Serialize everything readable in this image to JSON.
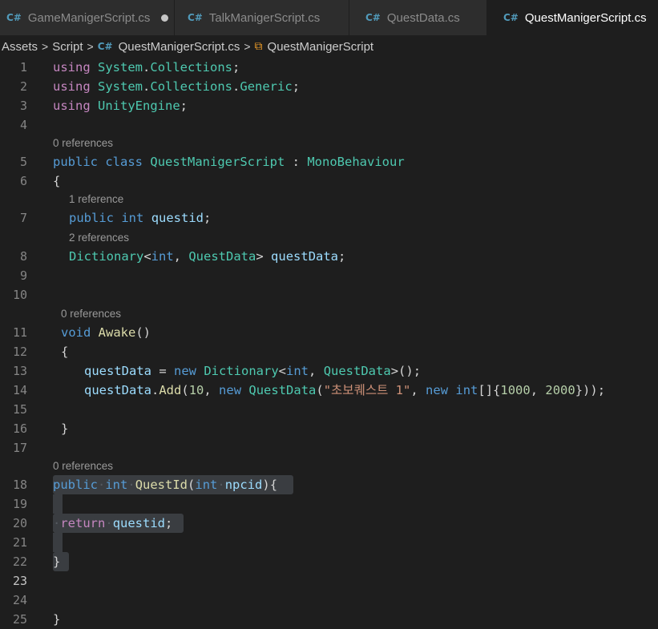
{
  "tabs": [
    {
      "label": "GameManigerScript.cs",
      "modified": true,
      "active": false
    },
    {
      "label": "TalkManigerScript.cs",
      "modified": false,
      "active": false
    },
    {
      "label": "QuestData.cs",
      "modified": false,
      "active": false
    },
    {
      "label": "QuestManigerScript.cs",
      "modified": false,
      "active": true
    }
  ],
  "breadcrumb": {
    "folder1": "Assets",
    "folder2": "Script",
    "file": "QuestManigerScript.cs",
    "symbol": "QuestManigerScript"
  },
  "editor": {
    "line_numbers": [
      "1",
      "2",
      "3",
      "4",
      "5",
      "6",
      "7",
      "8",
      "9",
      "10",
      "11",
      "12",
      "13",
      "14",
      "15",
      "16",
      "17",
      "18",
      "19",
      "20",
      "21",
      "22",
      "23",
      "24",
      "25"
    ],
    "codelens": {
      "class": "0 references",
      "questid": "1 reference",
      "questData": "2 references",
      "awake": "0 references",
      "questId_method": "0 references"
    },
    "tokens": {
      "using": "using",
      "System": "System",
      "dot": ".",
      "Collections": "Collections",
      "Generic": "Generic",
      "UnityEngine": "UnityEngine",
      "semicolon": ";",
      "public": "public",
      "class": "class",
      "className": "QuestManigerScript",
      "colon": " : ",
      "MonoBehaviour": "MonoBehaviour",
      "lbrace": "{",
      "rbrace": "}",
      "int": "int",
      "questid": "questid",
      "Dictionary": "Dictionary",
      "lt": "<",
      "gt": ">",
      "comma": ", ",
      "QuestData": "QuestData",
      "questData": "questData",
      "void": "void",
      "Awake": "Awake",
      "parens": "()",
      "assign": " = ",
      "new": "new",
      "callEnd": "();",
      "Add": "Add",
      "lparen": "(",
      "num10": "10",
      "questName": "\"초보퀘스트 1\"",
      "arrType": "[]{",
      "num1000": "1000",
      "num2000": "2000",
      "closeAll": "}));",
      "QuestId": "QuestId",
      "npcid": "npcid",
      "paramClose": "){",
      "return": "return",
      "space_dot": "·"
    }
  }
}
